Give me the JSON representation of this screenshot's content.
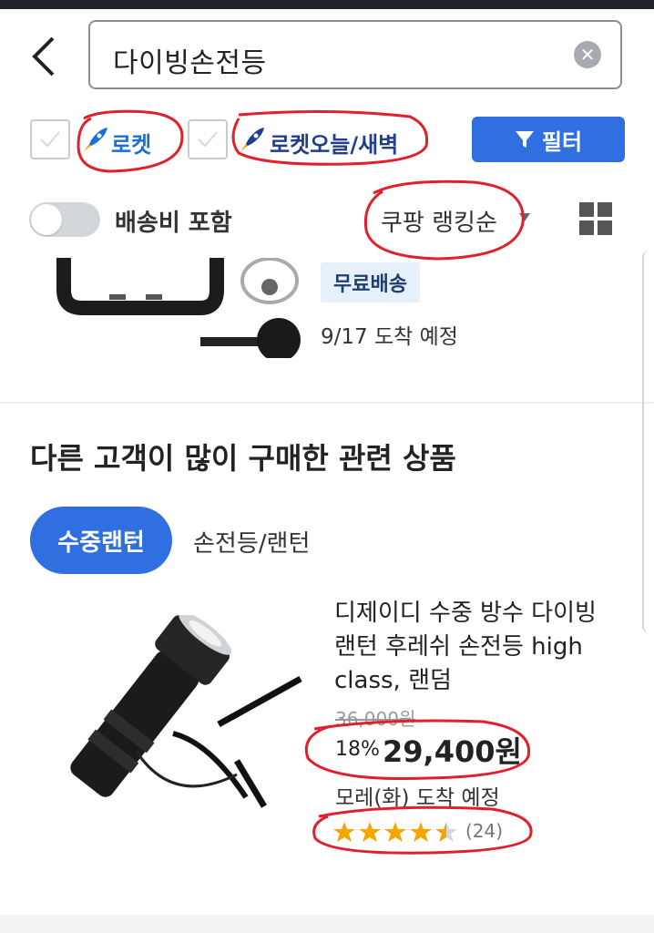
{
  "search": {
    "query": "다이빙손전등"
  },
  "filters": {
    "rocket_label": "로켓",
    "rocket_today_label": "로켓오늘/새벽",
    "filter_button_label": "필터"
  },
  "options": {
    "shipping_toggle_label": "배송비 포함",
    "sort_label": "쿠팡 랭킹순"
  },
  "previous_item": {
    "badge": "무료배송",
    "arrival": "9/17 도착 예정"
  },
  "related": {
    "title": "다른 고객이 많이 구매한 관련 상품",
    "tabs": [
      {
        "label": "수중랜턴",
        "active": true
      },
      {
        "label": "손전등/랜턴",
        "active": false
      }
    ]
  },
  "product": {
    "name": "디제이디 수중 방수 다이빙 랜턴 후레쉬 손전등 high class, 랜덤",
    "original_price": "36,000원",
    "discount": "18%",
    "price": "29,400원",
    "arrival": "모레(화) 도착 예정",
    "rating": 4.5,
    "review_count": "(24)"
  },
  "colors": {
    "accent": "#2f6fe0",
    "rocket": "#1a6fd8",
    "star": "#f5a500",
    "annotation": "#e0202a"
  }
}
